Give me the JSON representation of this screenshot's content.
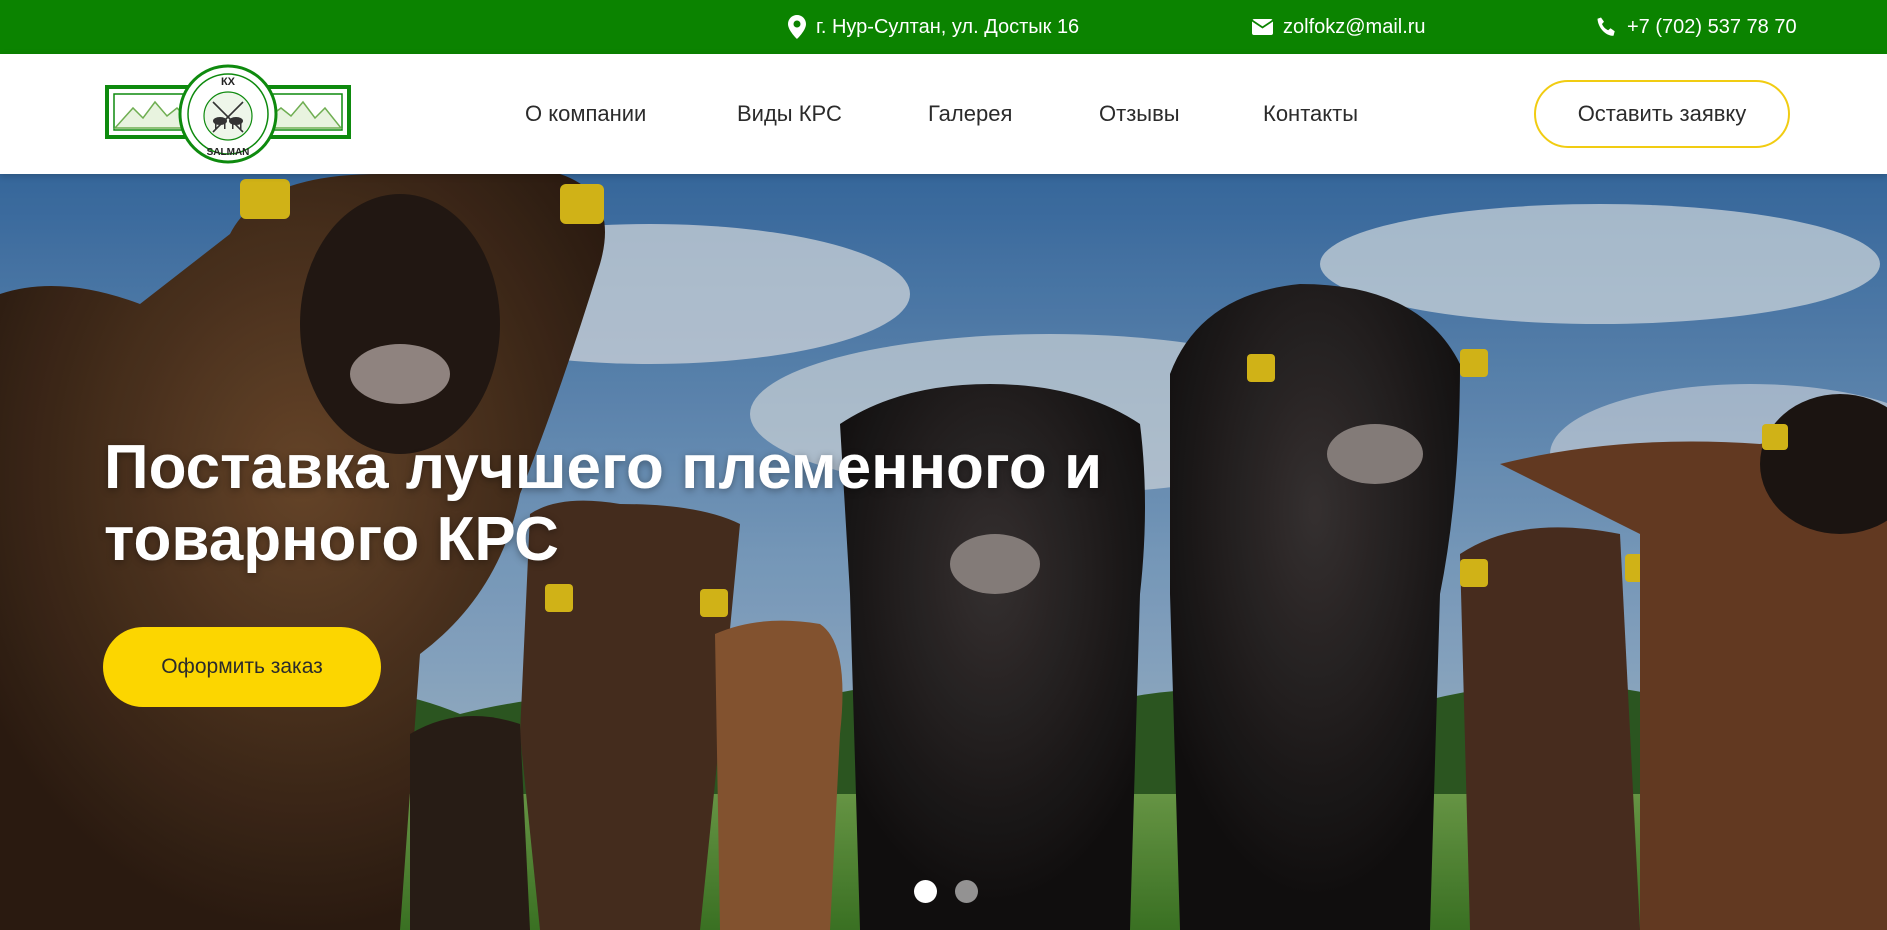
{
  "topbar": {
    "address": "г. Нур-Султан, ул. Достык 16",
    "email": "zolfokz@mail.ru",
    "phone": "+7 (702) 537 78 70"
  },
  "logo": {
    "top_text": "КХ",
    "bottom_text": "SALMAN"
  },
  "nav": {
    "items": [
      {
        "label": "О компании"
      },
      {
        "label": "Виды КРС"
      },
      {
        "label": "Галерея"
      },
      {
        "label": "Отзывы"
      },
      {
        "label": "Контакты"
      }
    ],
    "cta_label": "Оставить заявку"
  },
  "hero": {
    "title": "Поставка лучшего племенного и товарного КРС",
    "cta_label": "Оформить заказ",
    "slides": 2,
    "active_slide": 1
  },
  "colors": {
    "topbar_green": "#0b8300",
    "accent_yellow": "#fcd600",
    "outline_yellow": "#f1cc12",
    "text_dark": "#2b2b2b"
  },
  "icons": [
    "map-pin-icon",
    "envelope-icon",
    "phone-icon"
  ]
}
